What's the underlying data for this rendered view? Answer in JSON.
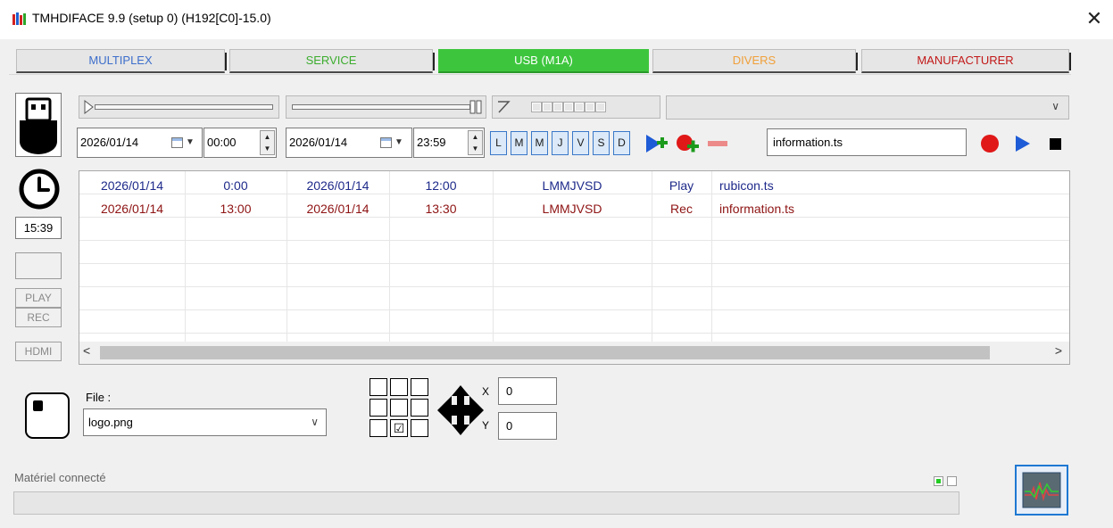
{
  "window": {
    "title": "TMHDIFACE 9.9 (setup 0) (H192[C0]-15.0)",
    "close_glyph": "✕"
  },
  "tabs": [
    {
      "label": "MULTIPLEX",
      "color": "#3c6ecb",
      "active": false
    },
    {
      "label": "SERVICE",
      "color": "#3cad2e",
      "active": false
    },
    {
      "label": "USB (M1A)",
      "color": "#ffffff",
      "active": true
    },
    {
      "label": "DIVERS",
      "color": "#f0a03a",
      "active": false
    },
    {
      "label": "MANUFACTURER",
      "color": "#c21818",
      "active": false
    }
  ],
  "left_panel": {
    "usb_icon": "usb-stick-icon",
    "clock_icon": "clock-icon",
    "time": "15:39",
    "play_label": "PLAY",
    "rec_label": "REC",
    "hdmi_label": "HDMI"
  },
  "schedule_editor": {
    "start_date": "2026/01/14",
    "start_time": "00:00",
    "end_date": "2026/01/14",
    "end_time": "23:59",
    "days": [
      "L",
      "M",
      "M",
      "J",
      "V",
      "S",
      "D"
    ],
    "file_name": "information.ts",
    "accent_color": "#1e5bd6",
    "record_color": "#e01818"
  },
  "schedule": {
    "rows": [
      {
        "start_date": "2026/01/14",
        "start_time": "0:00",
        "end_date": "2026/01/14",
        "end_time": "12:00",
        "days": "LMMJVSD",
        "mode": "Play",
        "file": "rubicon.ts"
      },
      {
        "start_date": "2026/01/14",
        "start_time": "13:00",
        "end_date": "2026/01/14",
        "end_time": "13:30",
        "days": "LMMJVSD",
        "mode": "Rec",
        "file": "information.ts"
      }
    ],
    "scroll_left": "<",
    "scroll_right": ">"
  },
  "logo": {
    "file_label": "File :",
    "file_value": "logo.png",
    "position_grid": [
      "",
      "",
      "",
      "",
      "",
      "",
      "",
      "☑",
      ""
    ],
    "x_label": "X",
    "x_value": "0",
    "y_label": "Y",
    "y_value": "0"
  },
  "status": {
    "label": "Matériel connecté"
  }
}
